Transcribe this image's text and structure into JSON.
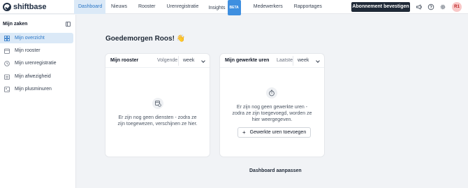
{
  "app": {
    "logo_text": "shiftbase"
  },
  "nav": {
    "items": [
      {
        "label": "Dashboard"
      },
      {
        "label": "Nieuws"
      },
      {
        "label": "Rooster"
      },
      {
        "label": "Urenregistratie"
      },
      {
        "label": "Insights",
        "badge": "BETA"
      },
      {
        "label": "Medewerkers"
      },
      {
        "label": "Rapportages"
      }
    ],
    "cta_label": "Abonnement bevestigen",
    "icons": [
      "megaphone-icon",
      "help-icon",
      "settings-icon"
    ],
    "avatar_initials": "R1"
  },
  "sidebar": {
    "title": "Mijn zaken",
    "items": [
      {
        "label": "Mijn overzicht",
        "icon": "grid-icon"
      },
      {
        "label": "Mijn rooster",
        "icon": "calendar-icon"
      },
      {
        "label": "Mijn urenregistratie",
        "icon": "clock-icon"
      },
      {
        "label": "Mijn afwezigheid",
        "icon": "absence-icon"
      },
      {
        "label": "Mijn plusminuren",
        "icon": "plusminus-icon"
      }
    ]
  },
  "main": {
    "greeting": "Goedemorgen Roos! 👋",
    "roster_card": {
      "title": "Mijn rooster",
      "filter_label": "Volgende",
      "filter_value": "week",
      "empty_text": "Er zijn nog geen diensten - zodra ze zijn toegewezen, verschijnen ze hier."
    },
    "hours_card": {
      "title": "Mijn gewerkte uren",
      "filter_label": "Laatste",
      "filter_value": "week",
      "empty_text": "Er zijn nog geen gewerkte uren - zodra ze zijn toegevoegd, worden ze hier weergegeven.",
      "button_label": "Gewerkte uren toevoegen"
    },
    "footer_link": "Dashboard aanpassen"
  },
  "colors": {
    "accent": "#2a76c6",
    "active_bg": "#dbe9f7",
    "cta_bg": "#1f2937",
    "badge_bg": "#3e8fe0"
  }
}
